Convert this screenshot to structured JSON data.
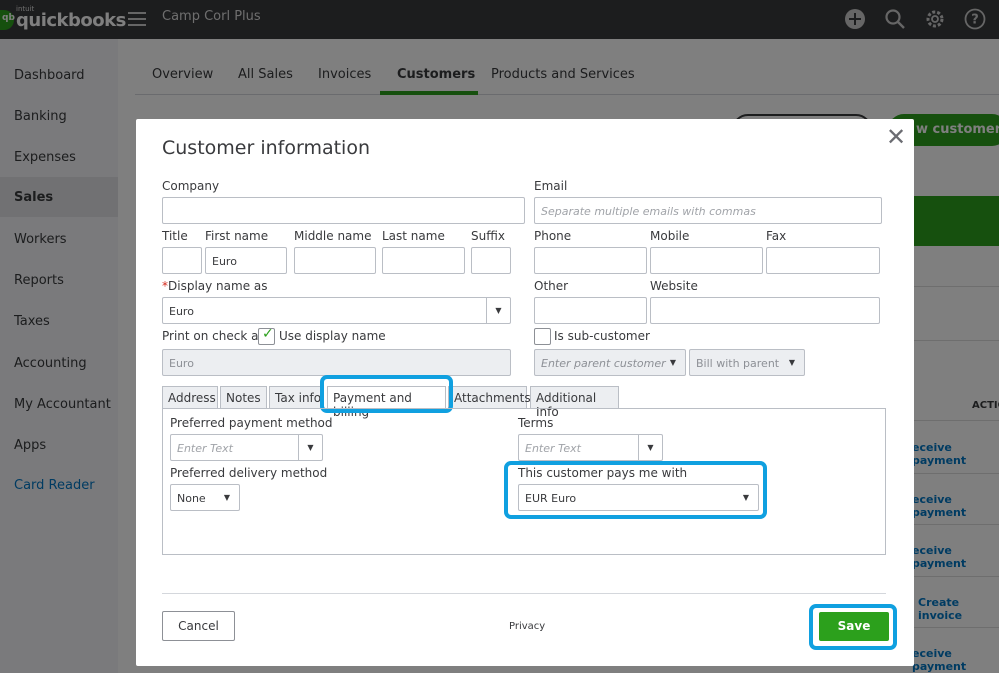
{
  "topbar": {
    "logo_intuit": "intuit",
    "logo_text": "quickbooks",
    "company": "Camp Corl Plus",
    "icons": [
      "plus-icon",
      "search-icon",
      "gear-icon",
      "help-icon"
    ]
  },
  "sidebar": {
    "items": [
      {
        "label": "Dashboard"
      },
      {
        "label": "Banking"
      },
      {
        "label": "Expenses"
      },
      {
        "label": "Sales"
      },
      {
        "label": "Workers"
      },
      {
        "label": "Reports"
      },
      {
        "label": "Taxes"
      },
      {
        "label": "Accounting"
      },
      {
        "label": "My Accountant"
      },
      {
        "label": "Apps"
      },
      {
        "label": "Card Reader"
      }
    ]
  },
  "subtabs": [
    "Overview",
    "All Sales",
    "Invoices",
    "Customers",
    "Products and Services"
  ],
  "background": {
    "new_customer": "w customer",
    "actions_header": "ACTIO",
    "actions": [
      "eceive payment",
      "eceive payment",
      "eceive payment",
      "Create invoice",
      "eceive payment"
    ]
  },
  "modal": {
    "title": "Customer information",
    "company_label": "Company",
    "company_value": "",
    "email_label": "Email",
    "email_placeholder": "Separate multiple emails with commas",
    "title_label": "Title",
    "first_name_label": "First name",
    "first_name_value": "Euro",
    "middle_name_label": "Middle name",
    "last_name_label": "Last name",
    "suffix_label": "Suffix",
    "phone_label": "Phone",
    "mobile_label": "Mobile",
    "fax_label": "Fax",
    "display_name_req": "*",
    "display_name_label": "Display name as",
    "display_name_value": "Euro",
    "other_label": "Other",
    "website_label": "Website",
    "print_on_check_label": "Print on check as",
    "use_display_name_label": "Use display name",
    "print_on_check_value": "Euro",
    "sub_customer_label": "Is sub-customer",
    "parent_customer_placeholder": "Enter parent customer",
    "bill_with_parent": "Bill with parent",
    "tabs": [
      "Address",
      "Notes",
      "Tax info",
      "Payment and billing",
      "Attachments",
      "Additional Info"
    ],
    "pref_payment_label": "Preferred payment method",
    "pref_payment_placeholder": "Enter Text",
    "terms_label": "Terms",
    "terms_placeholder": "Enter Text",
    "pref_delivery_label": "Preferred delivery method",
    "pref_delivery_value": "None",
    "currency_label": "This customer pays me with",
    "currency_value": "EUR Euro",
    "cancel": "Cancel",
    "privacy": "Privacy",
    "save": "Save"
  },
  "colors": {
    "brand_green": "#2ca01c",
    "topbar": "#393a3d",
    "highlight": "#10a0e0"
  }
}
